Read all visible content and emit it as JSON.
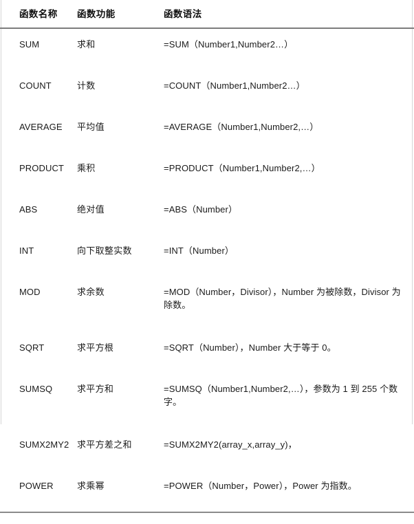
{
  "table": {
    "headers": [
      {
        "label": "函数名称"
      },
      {
        "label": "函数功能"
      },
      {
        "label": "函数语法"
      }
    ],
    "rows": [
      {
        "name": "SUM",
        "func": "求和",
        "syntax": "=SUM（Number1,Number2…）"
      },
      {
        "name": "COUNT",
        "func": "计数",
        "syntax": "=COUNT（Number1,Number2…）"
      },
      {
        "name": "AVERAGE",
        "func": "平均值",
        "syntax": "=AVERAGE（Number1,Number2,…）"
      },
      {
        "name": "PRODUCT",
        "func": "乘积",
        "syntax": "=PRODUCT（Number1,Number2,…）"
      },
      {
        "name": "ABS",
        "func": "绝对值",
        "syntax": "=ABS（Number）"
      },
      {
        "name": "INT",
        "func": "向下取整实数",
        "syntax": "=INT（Number）"
      },
      {
        "name": "MOD",
        "func": "求余数",
        "syntax": "=MOD（Number，Divisor），Number 为被除数，Divisor 为除数。"
      },
      {
        "name": "SQRT",
        "func": "求平方根",
        "syntax": "=SQRT（Number），Number 大于等于 0。"
      },
      {
        "name": "SUMSQ",
        "func": "求平方和",
        "syntax": "=SUMSQ（Number1,Number2,…），参数为 1 到 255 个数字。"
      },
      {
        "name": "SUMX2MY2",
        "func": "求平方差之和",
        "syntax": "=SUMX2MY2(array_x,array_y)，"
      },
      {
        "name": "POWER",
        "func": "求乘幂",
        "syntax": "=POWER（Number，Power），Power 为指数。"
      }
    ]
  },
  "colors": {
    "text": "#1b1b1b",
    "rule": "#7c7c7c",
    "frame": "#d5d5d5",
    "background": "#ffffff"
  }
}
